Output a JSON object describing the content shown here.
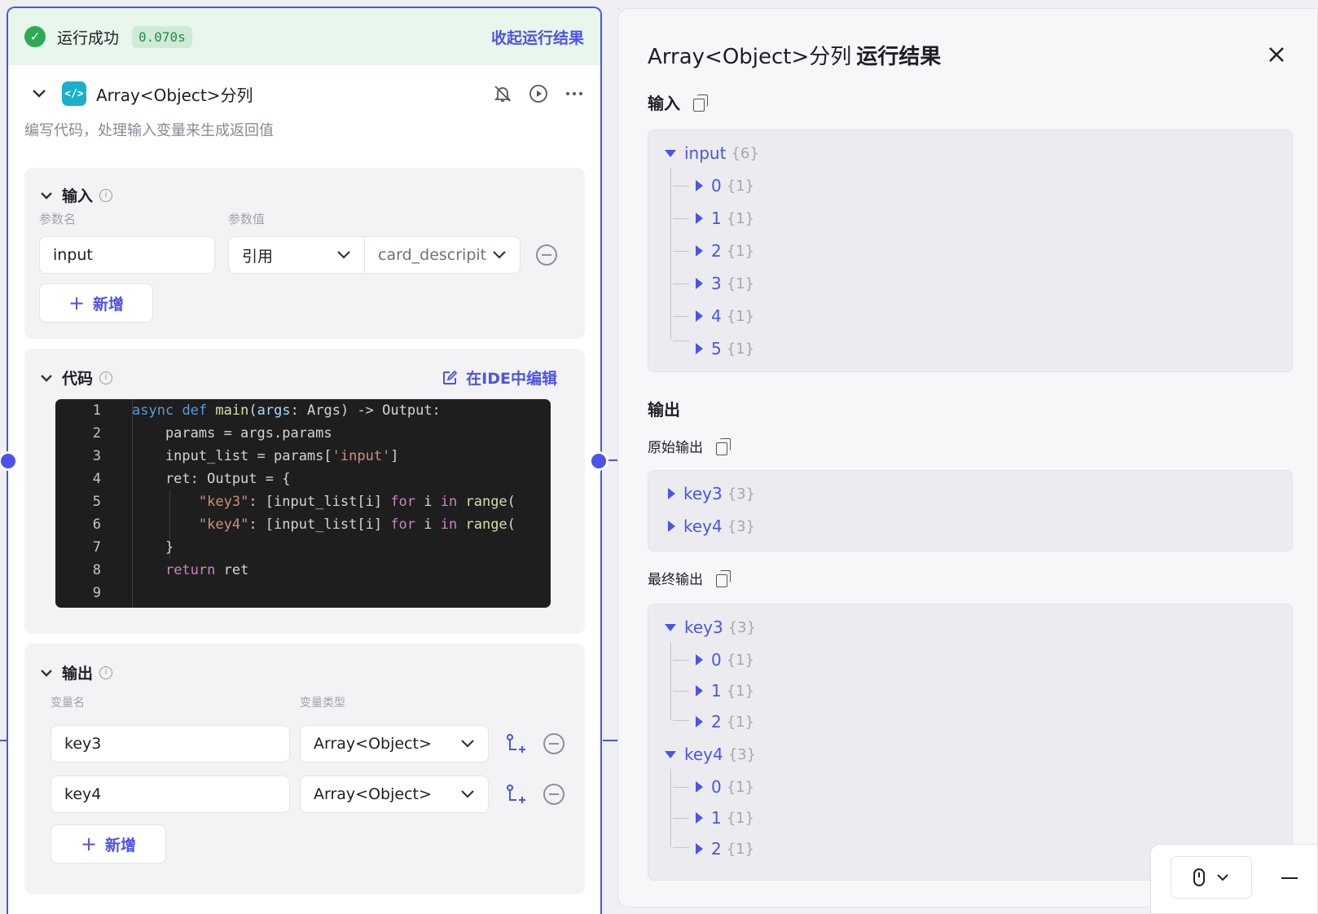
{
  "run": {
    "status": "运行成功",
    "time": "0.070s",
    "collapse_label": "收起运行结果"
  },
  "node": {
    "icon_text": "</>",
    "title": "Array<Object>分列",
    "description": "编写代码，处理输入变量来生成返回值"
  },
  "input_section": {
    "title": "输入",
    "col_name": "参数名",
    "col_value": "参数值",
    "param_name": "input",
    "ref_type": "引用",
    "ref_value": "card_descripit",
    "add_label": "新增"
  },
  "code_section": {
    "title": "代码",
    "ide_label": "在IDE中编辑",
    "line_numbers": [
      "1",
      "2",
      "3",
      "4",
      "5",
      "6",
      "7",
      "8",
      "9"
    ]
  },
  "output_section": {
    "title": "输出",
    "col_name": "变量名",
    "col_type": "变量类型",
    "rows": [
      {
        "name": "key3",
        "type": "Array<Object>"
      },
      {
        "name": "key4",
        "type": "Array<Object>"
      }
    ],
    "add_label": "新增"
  },
  "result": {
    "title_prefix": "Array<Object>分列",
    "title_suffix": "运行结果",
    "input_label": "输入",
    "output_label": "输出",
    "raw_output_label": "原始输出",
    "final_output_label": "最终输出",
    "input_tree": {
      "root": "input",
      "root_count": "{6}",
      "children": [
        {
          "key": "0",
          "count": "{1}"
        },
        {
          "key": "1",
          "count": "{1}"
        },
        {
          "key": "2",
          "count": "{1}"
        },
        {
          "key": "3",
          "count": "{1}"
        },
        {
          "key": "4",
          "count": "{1}"
        },
        {
          "key": "5",
          "count": "{1}"
        }
      ]
    },
    "raw_output_tree": [
      {
        "key": "key3",
        "count": "{3}"
      },
      {
        "key": "key4",
        "count": "{3}"
      }
    ],
    "final_output_tree": [
      {
        "key": "key3",
        "count": "{3}",
        "children": [
          {
            "key": "0",
            "count": "{1}"
          },
          {
            "key": "1",
            "count": "{1}"
          },
          {
            "key": "2",
            "count": "{1}"
          }
        ]
      },
      {
        "key": "key4",
        "count": "{3}",
        "children": [
          {
            "key": "0",
            "count": "{1}"
          },
          {
            "key": "1",
            "count": "{1}"
          },
          {
            "key": "2",
            "count": "{1}"
          }
        ]
      }
    ]
  },
  "colors": {
    "accent": "#4d53e8",
    "success": "#2eaa55",
    "node_icon": "#19b0c9",
    "code_bg": "#1e1e1e"
  }
}
